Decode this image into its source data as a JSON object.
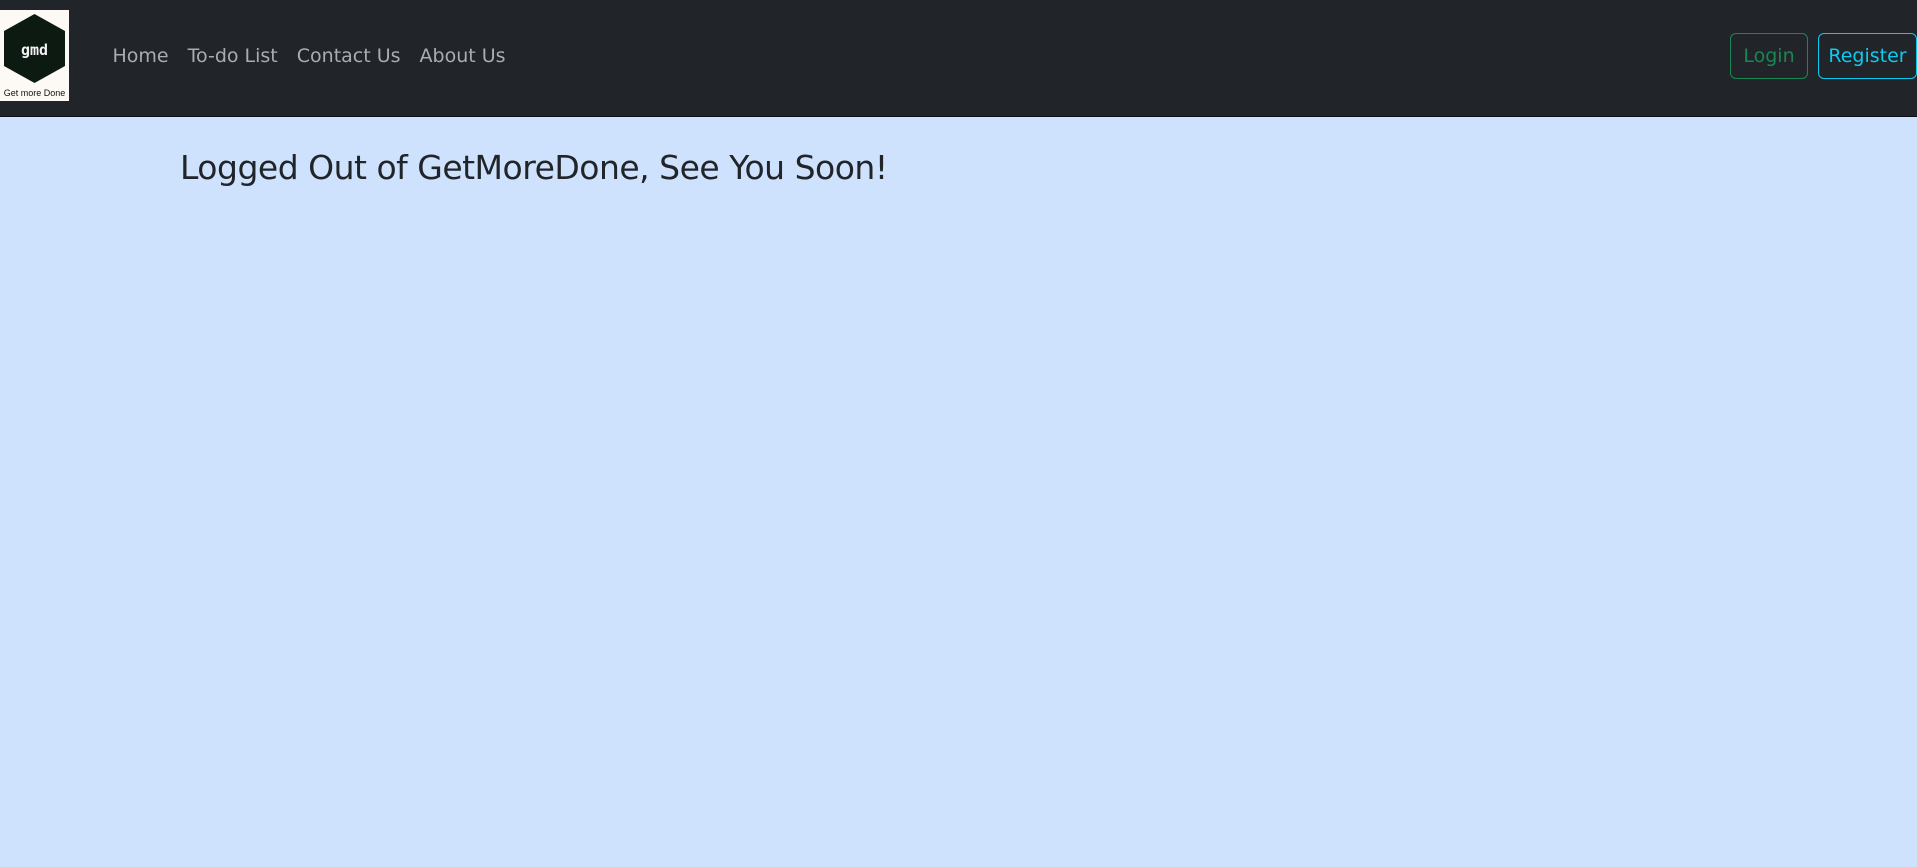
{
  "nav": {
    "logo": {
      "mark_text": "gmd",
      "caption": "Get more Done",
      "icon": "hexagon-logo-icon"
    },
    "links": [
      {
        "label": "Home"
      },
      {
        "label": "To-do List"
      },
      {
        "label": "Contact Us"
      },
      {
        "label": "About Us"
      }
    ],
    "login_label": "Login",
    "register_label": "Register"
  },
  "main": {
    "heading": "Logged Out of GetMoreDone, See You Soon!"
  },
  "colors": {
    "navbar_bg": "#212529",
    "page_bg": "#cfe2fd",
    "login_accent": "#198754",
    "register_accent": "#0dcaf0"
  }
}
